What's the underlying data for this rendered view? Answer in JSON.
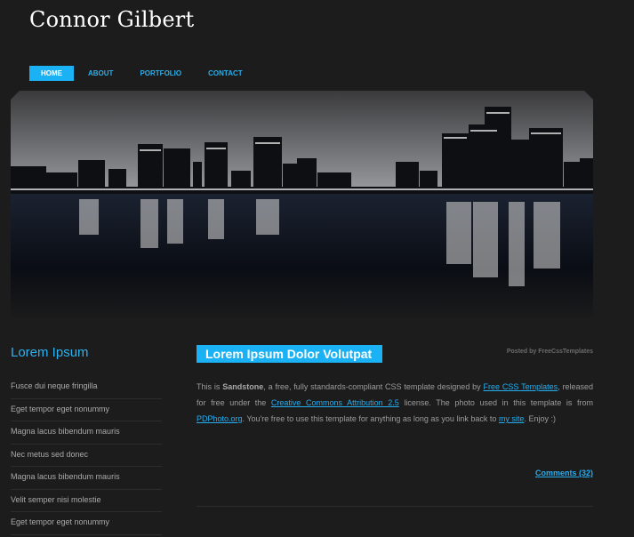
{
  "site": {
    "title": "Connor Gilbert"
  },
  "nav": {
    "items": [
      "Home",
      "About",
      "Portfolio",
      "Contact"
    ],
    "active_index": 0
  },
  "hero": {
    "description": "Night city skyline reflected in water"
  },
  "sidebar": {
    "heading": "Lorem Ipsum",
    "items": [
      "Fusce dui neque fringilla",
      "Eget tempor eget nonummy",
      "Magna lacus bibendum mauris",
      "Nec metus sed donec",
      "Magna lacus bibendum mauris",
      "Velit semper nisi molestie",
      "Eget tempor eget nonummy"
    ]
  },
  "post": {
    "title": "Lorem Ipsum Dolor Volutpat",
    "posted_by": "Posted by FreeCssTemplates",
    "body": {
      "t1": "This is ",
      "template_name": "Sandstone",
      "t2": ", a free, fully standards-compliant CSS template designed by ",
      "link1": "Free CSS Templates",
      "t3": ", released for free under the ",
      "link2": "Creative Commons Attribution 2.5",
      "t4": " license. The photo used in this template is from ",
      "link3": "PDPhoto.org",
      "t5": ". You're free to use this template for anything as long as you link back to ",
      "link4": "my site",
      "t6": ". Enjoy :)"
    },
    "comments": "Comments (32)"
  },
  "colors": {
    "accent": "#1ab2f5",
    "background": "#1c1c1c"
  }
}
